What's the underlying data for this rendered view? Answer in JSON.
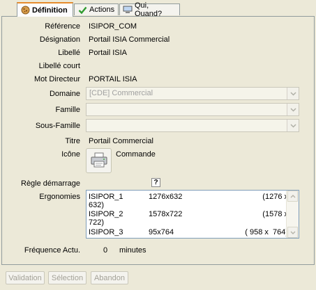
{
  "tabs": [
    {
      "label": "Définition",
      "icon": "cookie-icon"
    },
    {
      "label": "Actions",
      "icon": "checkmark-icon"
    },
    {
      "label": "Qui, Quand?",
      "icon": "computer-icon"
    }
  ],
  "form": {
    "reference": {
      "label": "Référence",
      "value": "ISIPOR_COM"
    },
    "designation": {
      "label": "Désignation",
      "value": "Portail ISIA Commercial"
    },
    "libelle": {
      "label": "Libellé",
      "value": "Portail ISIA"
    },
    "libelle_court": {
      "label": "Libellé court",
      "value": ""
    },
    "mot_directeur": {
      "label": "Mot Directeur",
      "value": "PORTAIL ISIA"
    },
    "domaine": {
      "label": "Domaine",
      "value": "[CDE] Commercial"
    },
    "famille": {
      "label": "Famille",
      "value": ""
    },
    "sous_famille": {
      "label": "Sous-Famille",
      "value": ""
    },
    "titre": {
      "label": "Titre",
      "value": "Portail Commercial"
    },
    "icone": {
      "label": "Icône",
      "value": "Commande",
      "icon": "printer-icon"
    },
    "regle_demarrage": {
      "label": "Règle démarrage",
      "button": "?"
    },
    "ergonomies": {
      "label": "Ergonomies",
      "rows": [
        {
          "name": "ISIPOR_1",
          "size": "1276x632",
          "paren_a": "(1276 x",
          "paren_b": "632)"
        },
        {
          "name": "ISIPOR_2",
          "size": "1578x722",
          "paren_a": "(1578 x",
          "paren_b": "722)"
        },
        {
          "name": "ISIPOR_3",
          "size": "95x764",
          "paren_a": "( 958 x  764)",
          "paren_b": ""
        }
      ]
    },
    "frequence": {
      "label": "Fréquence Actu.",
      "value": "0",
      "unit": "minutes"
    }
  },
  "buttons": {
    "validation": "Validation",
    "selection": "Sélection",
    "abandon": "Abandon"
  }
}
